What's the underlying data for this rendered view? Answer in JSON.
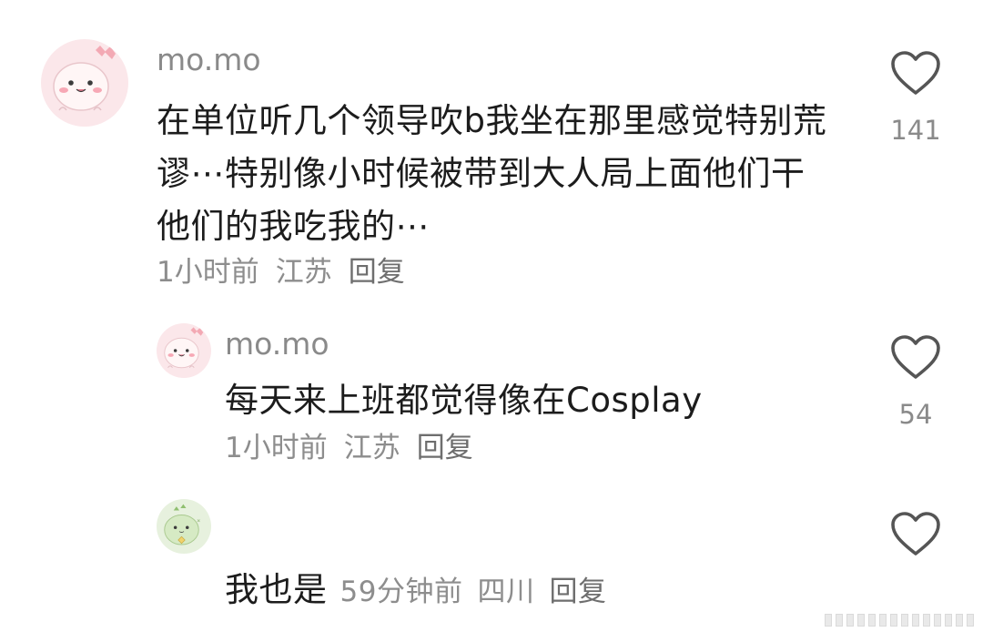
{
  "colors": {
    "username": "#8a8a8a",
    "content": "#1c1c1c",
    "meta": "#8d8d8d",
    "like_icon": "#555555"
  },
  "comments": [
    {
      "username": "mo.mo",
      "avatar_icon": "pink-dino-avatar",
      "content": "在单位听几个领导吹b我坐在那里感觉特别荒谬⋯特别像小时候被带到大人局上面他们干他们的我吃我的⋯",
      "time": "1小时前",
      "location": "江苏",
      "reply": "回复",
      "like_icon": "heart-outline-icon",
      "likes": "141"
    },
    {
      "username": "mo.mo",
      "avatar_icon": "pink-dino-avatar",
      "content": "每天来上班都觉得像在Cosplay",
      "time": "1小时前",
      "location": "江苏",
      "reply": "回复",
      "like_icon": "heart-outline-icon",
      "likes": "54"
    },
    {
      "username": "",
      "avatar_icon": "green-dino-avatar",
      "content": "我也是",
      "time": "59分钟前",
      "location": "四川",
      "reply": "回复",
      "like_icon": "heart-outline-icon",
      "likes": ""
    }
  ]
}
